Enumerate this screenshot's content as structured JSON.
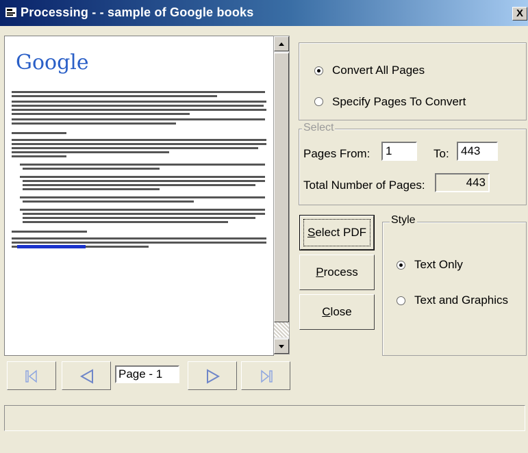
{
  "window": {
    "title": "Processing - - sample of Google books",
    "close_label": "X"
  },
  "preview": {
    "logo_text": "Google",
    "page_label": "Page - 1",
    "link_text": "books.google.com"
  },
  "conversion": {
    "option_all": "Convert All Pages",
    "option_specify": "Specify Pages To Convert",
    "selected": "all"
  },
  "select_group": {
    "legend": "Select",
    "from_label": "Pages From:",
    "from_value": "1",
    "to_label": "To:",
    "to_value": "443",
    "total_label": "Total Number of Pages:",
    "total_value": "443"
  },
  "buttons": {
    "select_pdf": {
      "mnemonic": "S",
      "rest": "elect PDF"
    },
    "process": {
      "mnemonic": "P",
      "rest": "rocess"
    },
    "close": {
      "mnemonic": "C",
      "rest": "lose"
    }
  },
  "style_group": {
    "legend": "Style",
    "option_text": "Text Only",
    "option_graphics": "Text and Graphics",
    "selected": "text"
  },
  "icons": [
    "app-icon",
    "close-icon",
    "scroll-up-icon",
    "scroll-down-icon",
    "first-page-icon",
    "prev-page-icon",
    "next-page-icon",
    "last-page-icon"
  ],
  "colors": {
    "title_gradient_start": "#0a246a",
    "title_gradient_end": "#a6caf0",
    "dialog_bg": "#ece9d8",
    "nav_arrow": "#8ea6e0"
  },
  "status": {
    "text": ""
  }
}
